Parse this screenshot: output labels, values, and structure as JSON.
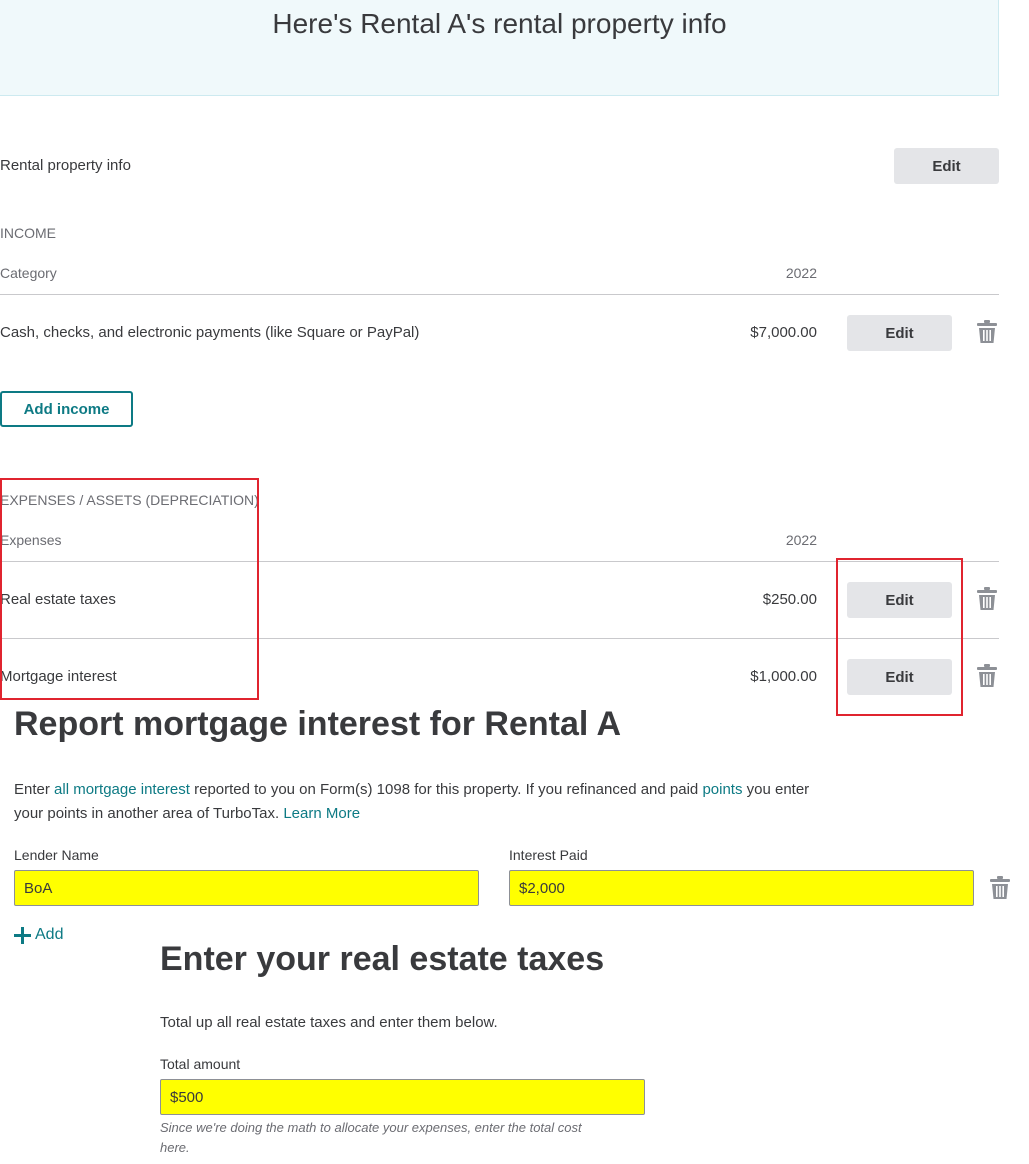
{
  "banner": {
    "title": "Here's Rental A's rental property info"
  },
  "property_info": {
    "label": "Rental property info",
    "edit_label": "Edit"
  },
  "income": {
    "section_title": "INCOME",
    "column_category": "Category",
    "column_year": "2022",
    "rows": [
      {
        "label": "Cash, checks, and electronic payments (like Square or PayPal)",
        "amount": "$7,000.00",
        "edit_label": "Edit"
      }
    ],
    "add_label": "Add income"
  },
  "expenses": {
    "section_title": "EXPENSES / ASSETS (DEPRECIATION)",
    "column_category": "Expenses",
    "column_year": "2022",
    "rows": [
      {
        "label": "Real estate taxes",
        "amount": "$250.00",
        "edit_label": "Edit"
      },
      {
        "label": "Mortgage interest",
        "amount": "$1,000.00",
        "edit_label": "Edit"
      }
    ]
  },
  "mortgage": {
    "heading": "Report mortgage interest for Rental A",
    "para": {
      "t1": "Enter ",
      "link1": "all mortgage interest",
      "t2": " reported to you on Form(s) 1098 for this property. If you refinanced and paid ",
      "link2": "points",
      "t3": " you enter",
      "t4": "your points in another area of TurboTax. ",
      "link3": "Learn More"
    },
    "lender_label": "Lender Name",
    "lender_value": "BoA",
    "interest_label": "Interest Paid",
    "interest_value": "$2,000",
    "add_label": "Add"
  },
  "taxes": {
    "heading": "Enter your real estate taxes",
    "para": "Total up all real estate taxes and enter them below.",
    "amount_label": "Total amount",
    "amount_value": "$500",
    "hint_line1": "Since we're doing the math to allocate your expenses, enter the total cost",
    "hint_line2": "here."
  },
  "icons": {
    "trash": "trash-icon",
    "plus": "plus-icon"
  },
  "colors": {
    "accent": "#0d7a84",
    "highlight": "#ffff00",
    "annotation": "#e0242f",
    "banner_bg": "#f0f9fb"
  }
}
